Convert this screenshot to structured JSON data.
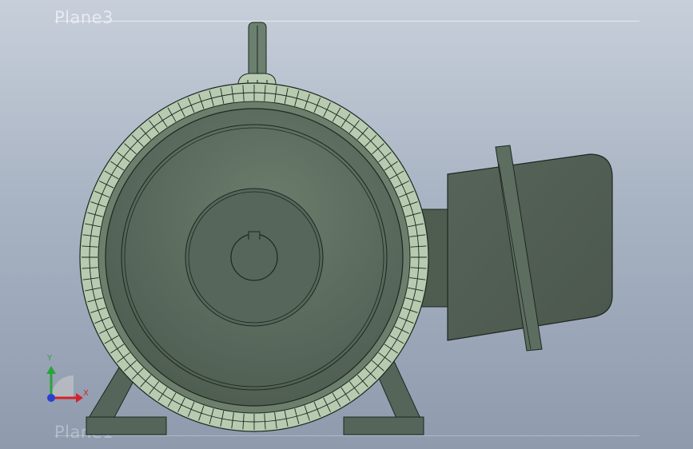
{
  "viewport": {
    "planes": [
      {
        "label": "Plane3"
      },
      {
        "label": "Plane1"
      }
    ],
    "triad": {
      "x_label": "X",
      "y_label": "Y"
    }
  },
  "colors": {
    "body": "#5b6b5e",
    "body_dark": "#4a5749",
    "fin_light": "#b7cbb0",
    "edge": "#1e2620",
    "axis_x": "#d4232a",
    "axis_y": "#2aa43a",
    "axis_z": "#2b3fd1"
  }
}
